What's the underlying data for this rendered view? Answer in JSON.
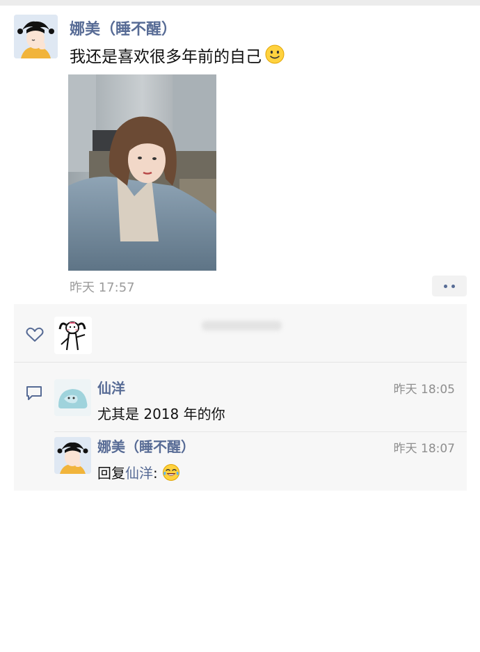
{
  "post": {
    "author": "娜美（睡不醒）",
    "text": "我还是喜欢很多年前的自己",
    "emoji_icon": "smile-emoji-icon",
    "time": "昨天 17:57",
    "more_icon": "more-dots-icon"
  },
  "likes": {
    "icon": "heart-icon",
    "users": [
      "liker-avatar"
    ]
  },
  "comments": [
    {
      "author": "仙洋",
      "time": "昨天 18:05",
      "text": "尤其是 2018 年的你"
    },
    {
      "author": "娜美（睡不醒）",
      "time": "昨天 18:07",
      "reply_prefix": "回复",
      "reply_target": "仙洋",
      "reply_colon": ":",
      "emoji_icon": "laughing-tears-emoji-icon"
    }
  ],
  "colors": {
    "link_blue": "#576b95",
    "panel_bg": "#f7f7f7",
    "time_gray": "#9b9b9b"
  }
}
